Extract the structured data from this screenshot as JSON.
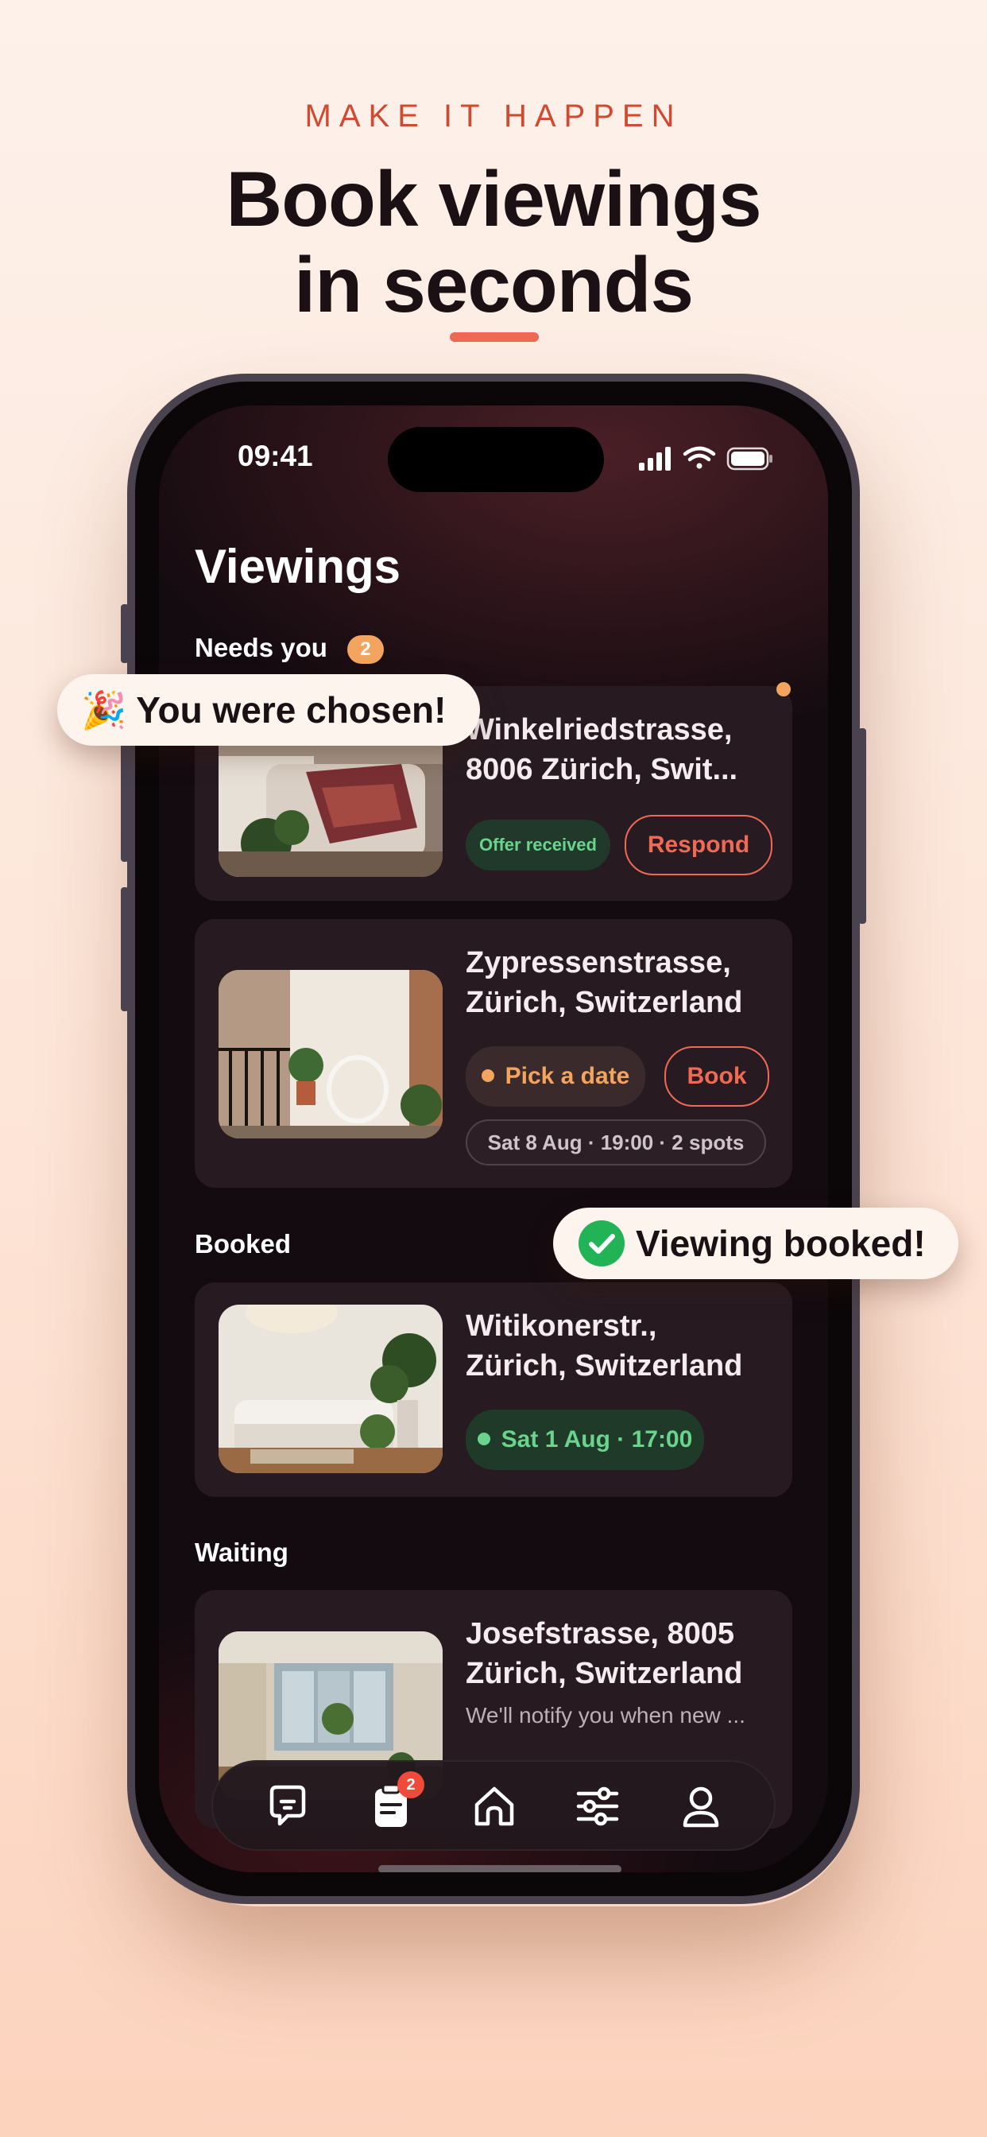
{
  "header": {
    "kicker": "MAKE IT HAPPEN",
    "headline_line1": "Book viewings",
    "headline_line2": "in seconds",
    "accent_color": "#ef6a55"
  },
  "status_bar": {
    "time": "09:41",
    "icons": [
      "signal-icon",
      "wifi-icon",
      "battery-icon"
    ]
  },
  "screen": {
    "title": "Viewings",
    "sections": {
      "needs_you": {
        "label": "Needs you",
        "count": "2"
      },
      "booked": {
        "label": "Booked"
      },
      "waiting": {
        "label": "Waiting"
      }
    },
    "cards": {
      "winkelried": {
        "address": "Winkelriedstrasse, 8006 Zürich, Swit...",
        "line1": "Winkelriedstrasse,",
        "line2": "8006 Zürich, Swit...",
        "status": "Offer received",
        "action": "Respond"
      },
      "zypressen": {
        "line1": "Zypressenstrasse,",
        "line2": "Zürich, Switzerland",
        "status": "Pick a date",
        "action": "Book",
        "slot": "Sat 8 Aug · 19:00  ·  2 spots"
      },
      "witikoner": {
        "line1": "Witikonerstr.,",
        "line2": "Zürich, Switzerland",
        "status": "Sat 1 Aug · 17:00"
      },
      "josef": {
        "line1": "Josefstrasse, 8005",
        "line2": "Zürich, Switzerland",
        "note": "We'll notify you when new ..."
      }
    },
    "tabbar": {
      "tabs": [
        {
          "name": "messages",
          "icon": "chat-icon"
        },
        {
          "name": "viewings",
          "icon": "clipboard-icon",
          "badge": "2"
        },
        {
          "name": "home",
          "icon": "home-icon"
        },
        {
          "name": "filters",
          "icon": "sliders-icon"
        },
        {
          "name": "profile",
          "icon": "person-icon"
        }
      ]
    }
  },
  "toasts": {
    "chosen": {
      "emoji": "🎉",
      "text": "You were chosen!"
    },
    "booked": {
      "text": "Viewing booked!"
    }
  },
  "colors": {
    "status_green": "#6ad38c",
    "status_orange": "#f3a45f",
    "accent_red": "#ef6a55",
    "badge_red": "#ef4a3a"
  }
}
